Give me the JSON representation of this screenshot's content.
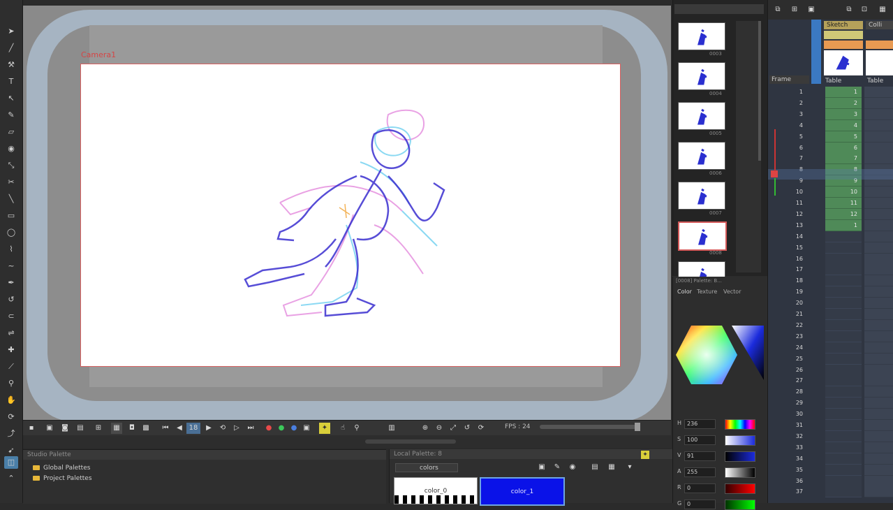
{
  "viewport": {
    "camera_label": "Camera1"
  },
  "thumbnails": {
    "items": [
      {
        "label": "0003"
      },
      {
        "label": "0004"
      },
      {
        "label": "0005"
      },
      {
        "label": "0006"
      },
      {
        "label": "0007"
      },
      {
        "label": "0008"
      },
      {
        "label": ""
      }
    ]
  },
  "playback": {
    "fps": "FPS : 24"
  },
  "studio_palette": {
    "title": "Studio Palette",
    "items": [
      "Global Palettes",
      "Project Palettes"
    ]
  },
  "colorview": {
    "title": "Local Palette: 8",
    "palette_name": "colors",
    "swatches": [
      {
        "label": "color_0",
        "color": "#ffffff"
      },
      {
        "label": "color_1",
        "color": "#0a12e8"
      }
    ]
  },
  "colorpanel": {
    "title": "[0008] Palette: B...",
    "tabs": [
      "Color",
      "Texture",
      "Vector"
    ],
    "sliders": [
      {
        "label": "H",
        "value": "236"
      },
      {
        "label": "S",
        "value": "100"
      },
      {
        "label": "V",
        "value": "91"
      },
      {
        "label": "A",
        "value": "255"
      },
      {
        "label": "R",
        "value": "0"
      },
      {
        "label": "G",
        "value": "0"
      }
    ]
  },
  "timeline": {
    "layers": [
      {
        "name": "Sketch"
      },
      {
        "name": "Colli"
      }
    ],
    "column_label": "Frame",
    "column_headers": [
      "Table",
      "Table"
    ],
    "frames": [
      "1",
      "2",
      "3",
      "4",
      "5",
      "6",
      "7",
      "8",
      "9",
      "10",
      "11",
      "12",
      "13",
      "14",
      "15",
      "16",
      "17",
      "18",
      "19",
      "20",
      "21",
      "22",
      "23",
      "24",
      "25",
      "26",
      "27",
      "28",
      "29",
      "30",
      "31",
      "32",
      "33",
      "34",
      "35",
      "36",
      "37"
    ],
    "cells": [
      "1",
      "2",
      "3",
      "4",
      "5",
      "6",
      "7",
      "8",
      "9",
      "10",
      "11",
      "12",
      "1"
    ]
  }
}
